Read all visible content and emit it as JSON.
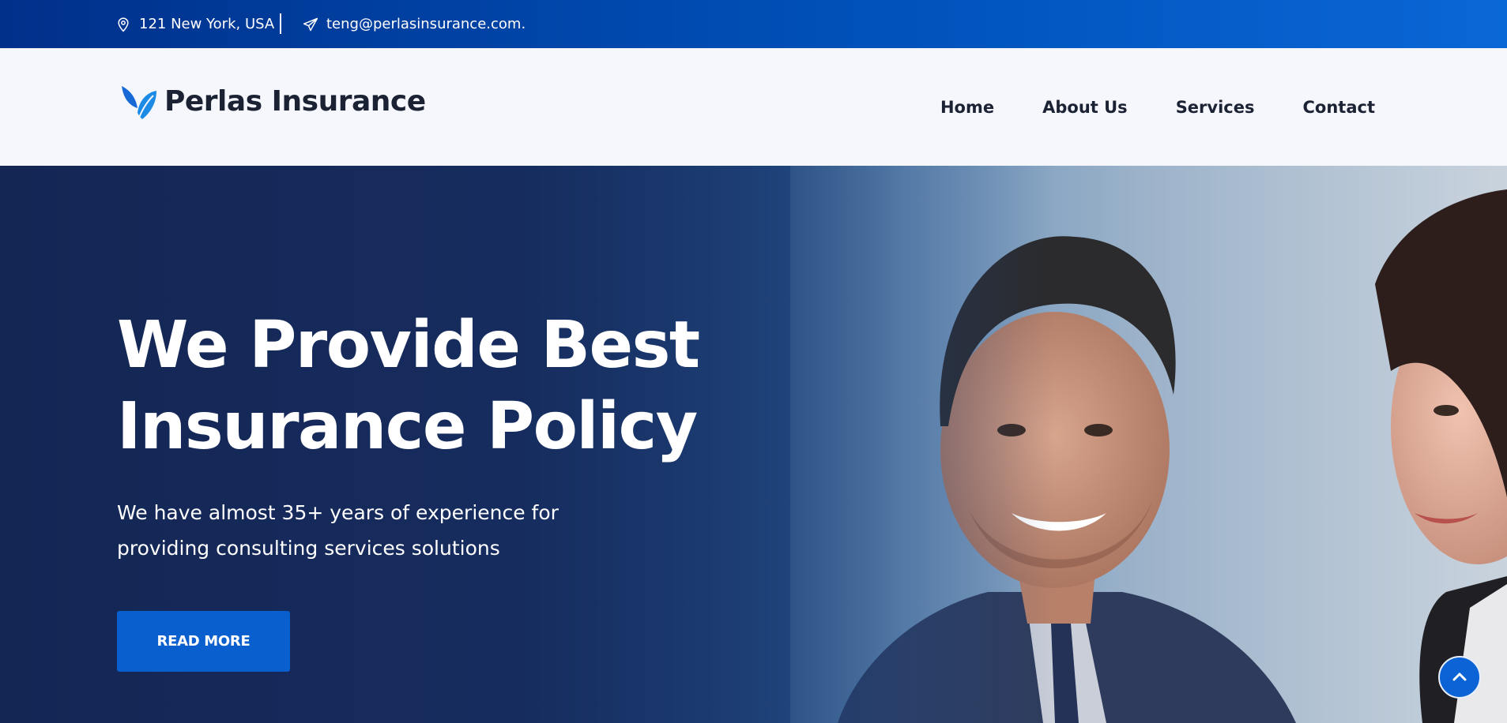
{
  "topbar": {
    "address": "121 New York, USA",
    "email": "teng@perlasinsurance.com.",
    "address_icon": "map-pin-icon",
    "email_icon": "paper-plane-icon"
  },
  "header": {
    "brand": "Perlas Insurance",
    "logo_icon": "leaf-logo-icon",
    "nav": [
      {
        "label": "Home"
      },
      {
        "label": "About Us"
      },
      {
        "label": "Services"
      },
      {
        "label": "Contact"
      }
    ]
  },
  "hero": {
    "title_line1": "We Provide Best",
    "title_line2": "Insurance Policy",
    "text_line1": "We have almost 35+ years of experience for",
    "text_line2": "providing consulting services solutions",
    "button_label": "READ MORE",
    "image": "businessman-and-businesswoman-photo"
  },
  "scroll_top": {
    "icon": "chevron-up-icon"
  },
  "colors": {
    "topbar": "#0050b8",
    "nav_bg": "#f5f7fd",
    "hero_dark": "#172a5a",
    "button": "#0a5fcf",
    "text_dark": "#1b2233"
  }
}
